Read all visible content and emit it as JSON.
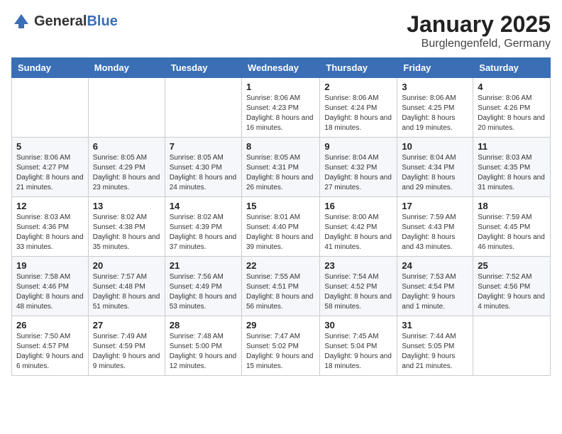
{
  "header": {
    "logo_general": "General",
    "logo_blue": "Blue",
    "month_title": "January 2025",
    "location": "Burglengenfeld, Germany"
  },
  "weekdays": [
    "Sunday",
    "Monday",
    "Tuesday",
    "Wednesday",
    "Thursday",
    "Friday",
    "Saturday"
  ],
  "weeks": [
    [
      {
        "day": "",
        "sunrise": "",
        "sunset": "",
        "daylight": ""
      },
      {
        "day": "",
        "sunrise": "",
        "sunset": "",
        "daylight": ""
      },
      {
        "day": "",
        "sunrise": "",
        "sunset": "",
        "daylight": ""
      },
      {
        "day": "1",
        "sunrise": "Sunrise: 8:06 AM",
        "sunset": "Sunset: 4:23 PM",
        "daylight": "Daylight: 8 hours and 16 minutes."
      },
      {
        "day": "2",
        "sunrise": "Sunrise: 8:06 AM",
        "sunset": "Sunset: 4:24 PM",
        "daylight": "Daylight: 8 hours and 18 minutes."
      },
      {
        "day": "3",
        "sunrise": "Sunrise: 8:06 AM",
        "sunset": "Sunset: 4:25 PM",
        "daylight": "Daylight: 8 hours and 19 minutes."
      },
      {
        "day": "4",
        "sunrise": "Sunrise: 8:06 AM",
        "sunset": "Sunset: 4:26 PM",
        "daylight": "Daylight: 8 hours and 20 minutes."
      }
    ],
    [
      {
        "day": "5",
        "sunrise": "Sunrise: 8:06 AM",
        "sunset": "Sunset: 4:27 PM",
        "daylight": "Daylight: 8 hours and 21 minutes."
      },
      {
        "day": "6",
        "sunrise": "Sunrise: 8:05 AM",
        "sunset": "Sunset: 4:29 PM",
        "daylight": "Daylight: 8 hours and 23 minutes."
      },
      {
        "day": "7",
        "sunrise": "Sunrise: 8:05 AM",
        "sunset": "Sunset: 4:30 PM",
        "daylight": "Daylight: 8 hours and 24 minutes."
      },
      {
        "day": "8",
        "sunrise": "Sunrise: 8:05 AM",
        "sunset": "Sunset: 4:31 PM",
        "daylight": "Daylight: 8 hours and 26 minutes."
      },
      {
        "day": "9",
        "sunrise": "Sunrise: 8:04 AM",
        "sunset": "Sunset: 4:32 PM",
        "daylight": "Daylight: 8 hours and 27 minutes."
      },
      {
        "day": "10",
        "sunrise": "Sunrise: 8:04 AM",
        "sunset": "Sunset: 4:34 PM",
        "daylight": "Daylight: 8 hours and 29 minutes."
      },
      {
        "day": "11",
        "sunrise": "Sunrise: 8:03 AM",
        "sunset": "Sunset: 4:35 PM",
        "daylight": "Daylight: 8 hours and 31 minutes."
      }
    ],
    [
      {
        "day": "12",
        "sunrise": "Sunrise: 8:03 AM",
        "sunset": "Sunset: 4:36 PM",
        "daylight": "Daylight: 8 hours and 33 minutes."
      },
      {
        "day": "13",
        "sunrise": "Sunrise: 8:02 AM",
        "sunset": "Sunset: 4:38 PM",
        "daylight": "Daylight: 8 hours and 35 minutes."
      },
      {
        "day": "14",
        "sunrise": "Sunrise: 8:02 AM",
        "sunset": "Sunset: 4:39 PM",
        "daylight": "Daylight: 8 hours and 37 minutes."
      },
      {
        "day": "15",
        "sunrise": "Sunrise: 8:01 AM",
        "sunset": "Sunset: 4:40 PM",
        "daylight": "Daylight: 8 hours and 39 minutes."
      },
      {
        "day": "16",
        "sunrise": "Sunrise: 8:00 AM",
        "sunset": "Sunset: 4:42 PM",
        "daylight": "Daylight: 8 hours and 41 minutes."
      },
      {
        "day": "17",
        "sunrise": "Sunrise: 7:59 AM",
        "sunset": "Sunset: 4:43 PM",
        "daylight": "Daylight: 8 hours and 43 minutes."
      },
      {
        "day": "18",
        "sunrise": "Sunrise: 7:59 AM",
        "sunset": "Sunset: 4:45 PM",
        "daylight": "Daylight: 8 hours and 46 minutes."
      }
    ],
    [
      {
        "day": "19",
        "sunrise": "Sunrise: 7:58 AM",
        "sunset": "Sunset: 4:46 PM",
        "daylight": "Daylight: 8 hours and 48 minutes."
      },
      {
        "day": "20",
        "sunrise": "Sunrise: 7:57 AM",
        "sunset": "Sunset: 4:48 PM",
        "daylight": "Daylight: 8 hours and 51 minutes."
      },
      {
        "day": "21",
        "sunrise": "Sunrise: 7:56 AM",
        "sunset": "Sunset: 4:49 PM",
        "daylight": "Daylight: 8 hours and 53 minutes."
      },
      {
        "day": "22",
        "sunrise": "Sunrise: 7:55 AM",
        "sunset": "Sunset: 4:51 PM",
        "daylight": "Daylight: 8 hours and 56 minutes."
      },
      {
        "day": "23",
        "sunrise": "Sunrise: 7:54 AM",
        "sunset": "Sunset: 4:52 PM",
        "daylight": "Daylight: 8 hours and 58 minutes."
      },
      {
        "day": "24",
        "sunrise": "Sunrise: 7:53 AM",
        "sunset": "Sunset: 4:54 PM",
        "daylight": "Daylight: 9 hours and 1 minute."
      },
      {
        "day": "25",
        "sunrise": "Sunrise: 7:52 AM",
        "sunset": "Sunset: 4:56 PM",
        "daylight": "Daylight: 9 hours and 4 minutes."
      }
    ],
    [
      {
        "day": "26",
        "sunrise": "Sunrise: 7:50 AM",
        "sunset": "Sunset: 4:57 PM",
        "daylight": "Daylight: 9 hours and 6 minutes."
      },
      {
        "day": "27",
        "sunrise": "Sunrise: 7:49 AM",
        "sunset": "Sunset: 4:59 PM",
        "daylight": "Daylight: 9 hours and 9 minutes."
      },
      {
        "day": "28",
        "sunrise": "Sunrise: 7:48 AM",
        "sunset": "Sunset: 5:00 PM",
        "daylight": "Daylight: 9 hours and 12 minutes."
      },
      {
        "day": "29",
        "sunrise": "Sunrise: 7:47 AM",
        "sunset": "Sunset: 5:02 PM",
        "daylight": "Daylight: 9 hours and 15 minutes."
      },
      {
        "day": "30",
        "sunrise": "Sunrise: 7:45 AM",
        "sunset": "Sunset: 5:04 PM",
        "daylight": "Daylight: 9 hours and 18 minutes."
      },
      {
        "day": "31",
        "sunrise": "Sunrise: 7:44 AM",
        "sunset": "Sunset: 5:05 PM",
        "daylight": "Daylight: 9 hours and 21 minutes."
      },
      {
        "day": "",
        "sunrise": "",
        "sunset": "",
        "daylight": ""
      }
    ]
  ]
}
